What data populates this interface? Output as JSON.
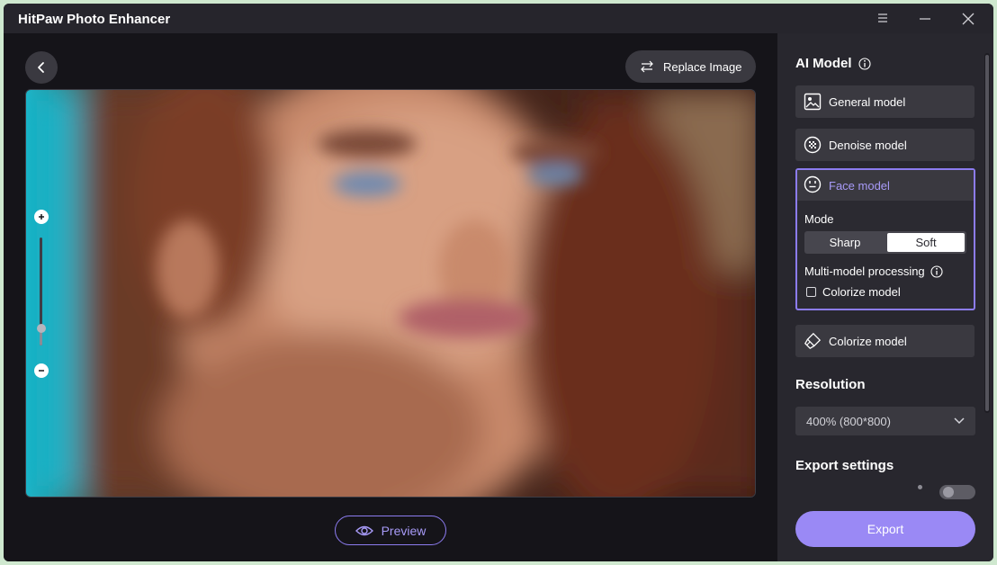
{
  "window": {
    "title": "HitPaw Photo Enhancer"
  },
  "toolbar": {
    "replace_label": "Replace Image",
    "preview_label": "Preview"
  },
  "panel": {
    "ai_model_title": "AI Model",
    "models": {
      "general": "General model",
      "denoise": "Denoise model",
      "face": "Face model",
      "colorize": "Colorize model"
    },
    "face_options": {
      "mode_label": "Mode",
      "mode_options": [
        "Sharp",
        "Soft"
      ],
      "mode_selected": "Soft",
      "multi_label": "Multi-model processing",
      "colorize_checkbox_label": "Colorize model",
      "colorize_checked": false
    },
    "resolution_title": "Resolution",
    "resolution_value": "400% (800*800)",
    "export_settings_title": "Export settings",
    "export_label": "Export"
  },
  "colors": {
    "accent": "#8c7cf0",
    "export_button": "#9a89f5",
    "panel_bg": "#28272e",
    "main_bg": "#151419"
  },
  "icons": [
    "menu-icon",
    "minimize-icon",
    "close-icon",
    "back-arrow-icon",
    "swap-arrows-icon",
    "zoom-in-icon",
    "zoom-out-icon",
    "eye-icon",
    "info-icon",
    "image-icon",
    "denoise-icon",
    "face-icon",
    "colorize-brush-icon",
    "chevron-down-icon"
  ]
}
